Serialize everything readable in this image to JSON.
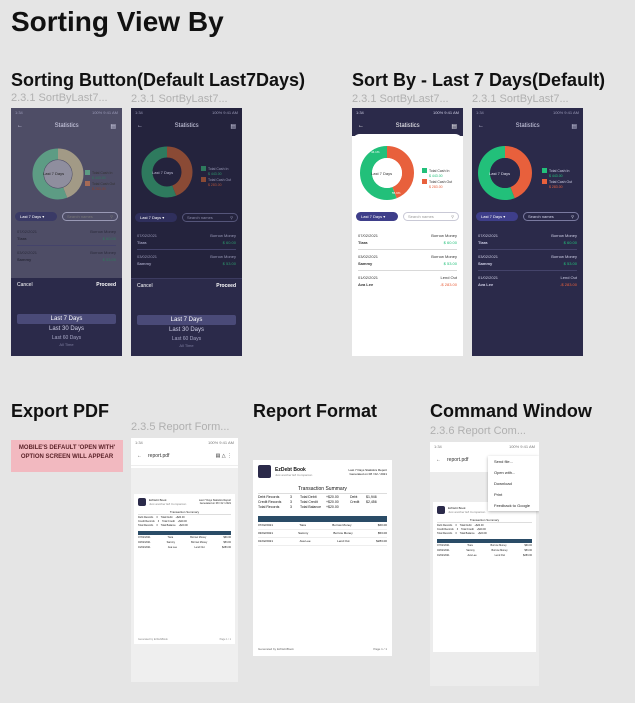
{
  "page_title": "Sorting View By",
  "sections": {
    "sorting_button": "Sorting Button(Default Last7Days)",
    "sort_by": "Sort By - Last 7 Days(Default)",
    "export_pdf": "Export PDF",
    "report_format": "Report Format",
    "command_window": "Command Window"
  },
  "captions": {
    "c1": "2.3.1 SortByLast7...",
    "c2": "2.3.1 SortByLast7...",
    "c3": "2.3.1 SortByLast7...",
    "c4": "2.3.1 SortByLast7...",
    "c5": "2.3.5 Report Form...",
    "c6": "2.3.6 Report Com..."
  },
  "note_text": "MOBILE'S DEFAULT 'OPEN WITH' OPTION SCREEN WILL APPEAR",
  "stats": {
    "title": "Statistics",
    "status_left": "1:34",
    "status_right": "100% 9:41 AM",
    "donut_center": "Last 7 Days",
    "legend_in_label": "Total Cash In",
    "legend_in_value": "$ 443.00",
    "legend_out_label": "Total Cash Out",
    "legend_out_value": "$ 283.00",
    "pct_out": "44.1%",
    "pct_in": "55.9%",
    "filter": "Last 7 Days",
    "search_placeholder": "Search names",
    "entries": [
      {
        "date": "07/02/2021",
        "type": "Borrow Money",
        "name": "Tiara",
        "amount": "$ 60.00"
      },
      {
        "date": "03/02/2021",
        "type": "Borrow Money",
        "name": "Sammy",
        "amount": "$ 53.00"
      },
      {
        "date": "01/02/2021",
        "type": "Lend Out",
        "name": "Ava Lee",
        "amount": "-$ 283.00"
      }
    ],
    "sheet_cancel": "Cancel",
    "sheet_proceed": "Proceed",
    "options": [
      "Last 7 Days",
      "Last 30 Days",
      "Last 60 Days",
      "All Time"
    ]
  },
  "pdf": {
    "filename": "report.pdf",
    "app_name": "EzDebt Book",
    "app_sub": "Just another EZ Companion",
    "report_title": "Last 7 Days Statistics Report",
    "generated": "Generated on 08 / 02 / 2021",
    "summary_title": "Transaction Summary",
    "summary": [
      {
        "label": "Debt Records",
        "count": "3",
        "k1": "Total Debit",
        "v1": "+$20.00",
        "k2": "Debt",
        "v2": "$1,946"
      },
      {
        "label": "Credit Records",
        "count": "3",
        "k1": "Total Credit",
        "v1": "+$20.00",
        "k2": "Credit",
        "v2": "$2,456"
      },
      {
        "label": "Total Records",
        "count": "3",
        "k1": "Total Balance",
        "v1": "+$20.00",
        "k2": "",
        "v2": ""
      }
    ],
    "table_rows": [
      {
        "date": "07/02/2021",
        "name": "Tiara",
        "type": "Borrow Money",
        "amount": "$60.00"
      },
      {
        "date": "03/02/2021",
        "name": "Sammy",
        "type": "Borrow Money",
        "amount": "$53.00"
      },
      {
        "date": "01/02/2021",
        "name": "Ava Lee",
        "type": "Lend Out",
        "amount": "$283.00"
      }
    ],
    "footer_left": "Generated by EzDebtBook",
    "footer_right": "Page 1 / 1"
  },
  "command_menu": [
    "Send file...",
    "Open with...",
    "Download",
    "Print",
    "Feedback to Google"
  ]
}
